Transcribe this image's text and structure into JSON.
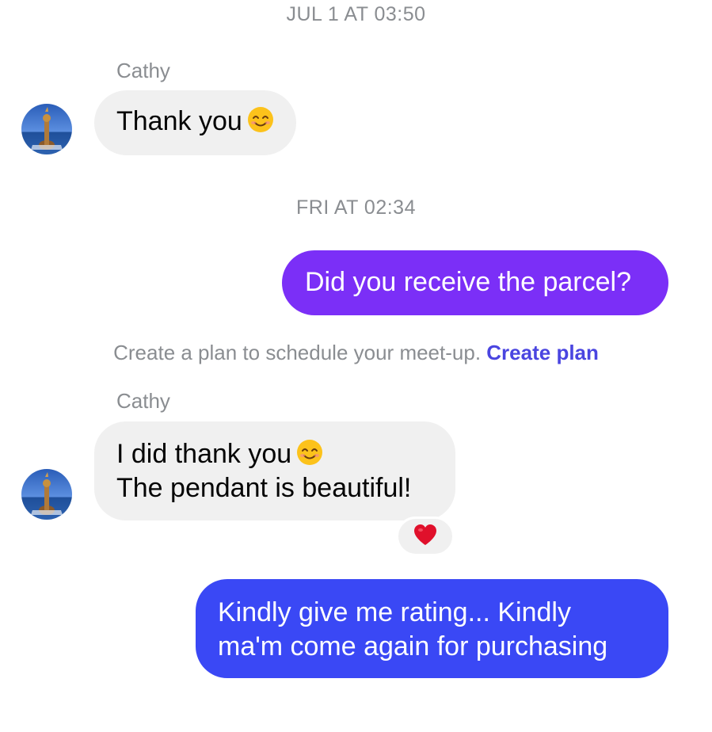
{
  "conversation": {
    "timestamp_1": "JUL 1 AT 03:50",
    "timestamp_2": "FRI AT 02:34",
    "messages": [
      {
        "sender": "Cathy",
        "text": "Thank you",
        "emoji": "smiling-face-icon"
      },
      {
        "sender": "me",
        "text": "Did you receive the parcel?"
      },
      {
        "sender": "Cathy",
        "line_1": "I did thank you",
        "line_1_emoji": "smiling-face-icon",
        "line_2": "The pendant is beautiful!",
        "reaction": "red-heart-icon"
      },
      {
        "sender": "me",
        "line_1": "Kindly give me rating... Kindly",
        "line_2": "ma'm come again for purchasing"
      }
    ],
    "plan_prompt": {
      "text": "Create a plan to schedule your meet-up. ",
      "link": "Create plan"
    }
  },
  "colors": {
    "incoming_bubble": "#f0f0f0",
    "outgoing_purple": "#7b2ff7",
    "outgoing_blue": "#3a48f5",
    "meta_text": "#8a8d91",
    "link": "#4a45e0",
    "reaction_heart": "#e0102b"
  }
}
